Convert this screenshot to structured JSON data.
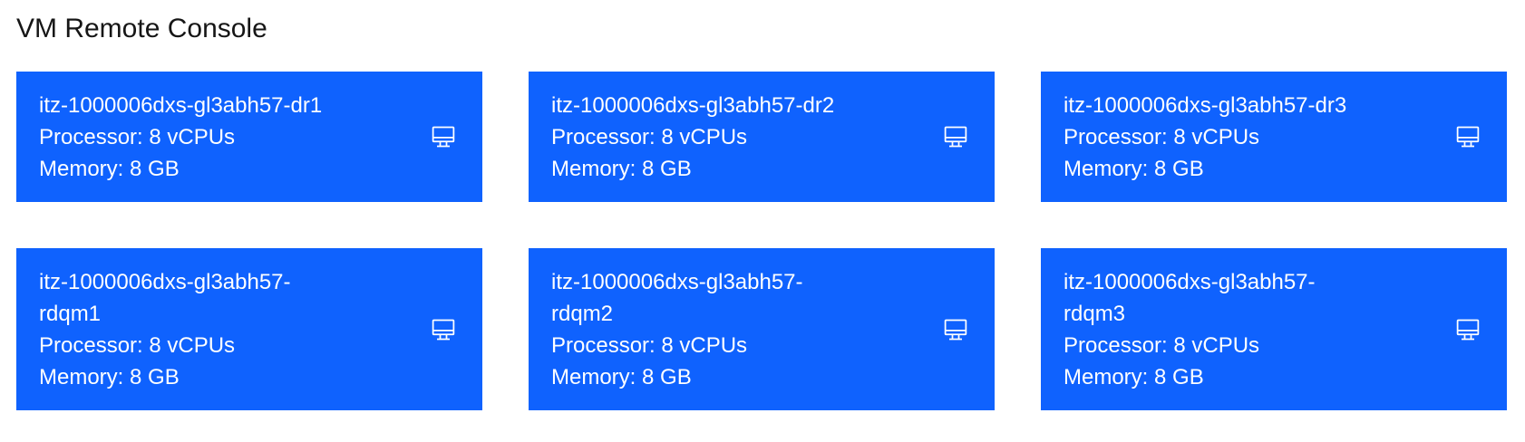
{
  "page": {
    "title": "VM Remote Console"
  },
  "colors": {
    "tile_background": "#0f62fe",
    "tile_text": "#ffffff",
    "title_text": "#161616"
  },
  "vms": [
    {
      "name": "itz-1000006dxs-gl3abh57-dr1",
      "processor": "Processor: 8 vCPUs",
      "memory": "Memory: 8 GB",
      "icon": "monitor-icon"
    },
    {
      "name": "itz-1000006dxs-gl3abh57-dr2",
      "processor": "Processor: 8 vCPUs",
      "memory": "Memory: 8 GB",
      "icon": "monitor-icon"
    },
    {
      "name": "itz-1000006dxs-gl3abh57-dr3",
      "processor": "Processor: 8 vCPUs",
      "memory": "Memory: 8 GB",
      "icon": "monitor-icon"
    },
    {
      "name": "itz-1000006dxs-gl3abh57-rdqm1",
      "processor": "Processor: 8 vCPUs",
      "memory": "Memory: 8 GB",
      "icon": "monitor-icon"
    },
    {
      "name": "itz-1000006dxs-gl3abh57-rdqm2",
      "processor": "Processor: 8 vCPUs",
      "memory": "Memory: 8 GB",
      "icon": "monitor-icon"
    },
    {
      "name": "itz-1000006dxs-gl3abh57-rdqm3",
      "processor": "Processor: 8 vCPUs",
      "memory": "Memory: 8 GB",
      "icon": "monitor-icon"
    }
  ]
}
